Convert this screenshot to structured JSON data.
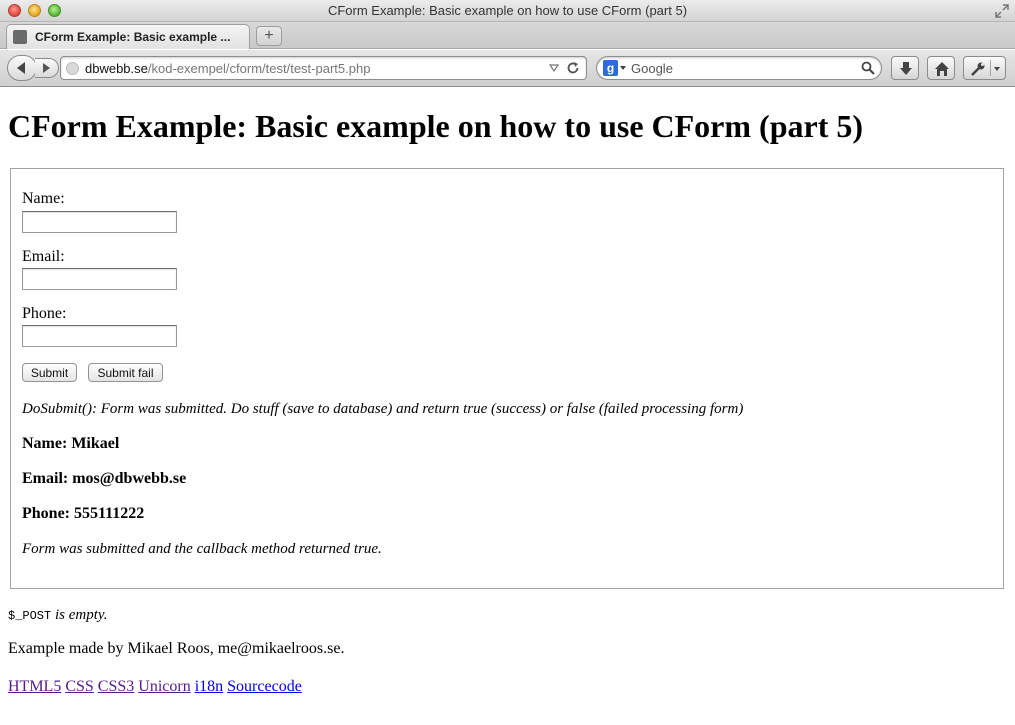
{
  "window": {
    "title": "CForm Example: Basic example on how to use CForm (part 5)"
  },
  "tabs": [
    {
      "label": "CForm Example: Basic example ..."
    }
  ],
  "new_tab_label": "+",
  "address_bar": {
    "host": "dbwebb.se",
    "path": "/kod-exempel/cform/test/test-part5.php"
  },
  "search_bar": {
    "engine_letter": "g",
    "placeholder": "Google"
  },
  "page": {
    "title": "CForm Example: Basic example on how to use CForm (part 5)",
    "form": {
      "fields": [
        {
          "label": "Name:",
          "value": ""
        },
        {
          "label": "Email:",
          "value": ""
        },
        {
          "label": "Phone:",
          "value": ""
        }
      ],
      "submit_label": "Submit",
      "submit_fail_label": "Submit fail",
      "output": {
        "dosubmit_message": "DoSubmit(): Form was submitted. Do stuff (save to database) and return true (success) or false (failed processing form)",
        "name_line": "Name: Mikael",
        "email_line": "Email: mos@dbwebb.se",
        "phone_line": "Phone: 555111222",
        "result_message": "Form was submitted and the callback method returned true."
      }
    },
    "post_var": "$_POST",
    "post_status": " is empty.",
    "footer_credit": "Example made by Mikael Roos, me@mikaelroos.se.",
    "footer_links": [
      {
        "label": "HTML5",
        "visited": true
      },
      {
        "label": "CSS",
        "visited": true
      },
      {
        "label": "CSS3",
        "visited": true
      },
      {
        "label": "Unicorn",
        "visited": true
      },
      {
        "label": "i18n",
        "visited": false
      },
      {
        "label": "Sourcecode",
        "visited": false
      }
    ]
  },
  "colors": {
    "link": "#0000ee",
    "visited_link": "#551a8b"
  }
}
